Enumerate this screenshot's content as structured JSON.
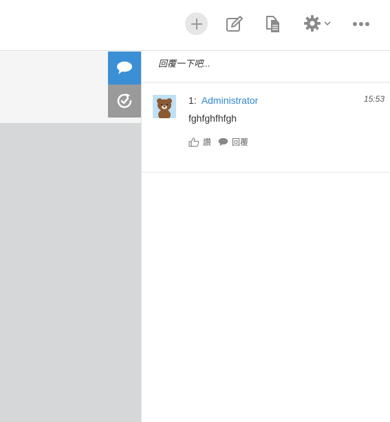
{
  "toolbar": {
    "icons": [
      "plus-icon",
      "edit-icon",
      "document-icon",
      "gear-icon",
      "chevron-down-icon",
      "more-icon"
    ]
  },
  "side_tabs": [
    {
      "icon": "comment-icon",
      "color": "#3b8fd5"
    },
    {
      "icon": "history-icon",
      "color": "#9a9a9a"
    }
  ],
  "reply": {
    "placeholder": "回覆一下吧..."
  },
  "comments": [
    {
      "index": "1:",
      "author": "Administrator",
      "time": "15:53",
      "body": "fghfghfhfgh",
      "like_label": "讚",
      "reply_label": "回覆"
    }
  ],
  "colors": {
    "accent": "#3b8fd5",
    "author_link": "#2f85cc",
    "left_panel_bg": "#d5d7d9"
  }
}
